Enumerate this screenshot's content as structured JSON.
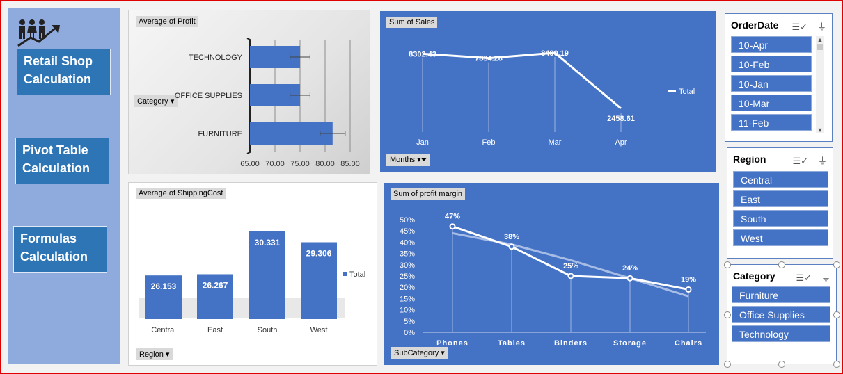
{
  "nav": {
    "retail": "Retail Shop Calculation",
    "pivot": "Pivot Table Calculation",
    "formulas": "Formulas Calculation"
  },
  "profit_chart": {
    "title": "Average of Profit",
    "filter_label": "Category",
    "chart_data": {
      "type": "bar",
      "categories": [
        "TECHNOLOGY",
        "OFFICE SUPPLIES",
        "FURNITURE"
      ],
      "values": [
        75.0,
        75.0,
        81.5
      ],
      "error": [
        2.0,
        2.0,
        2.5
      ],
      "xlim": [
        65,
        85
      ],
      "xticks": [
        "65.00",
        "70.00",
        "75.00",
        "80.00",
        "85.00"
      ]
    }
  },
  "sales_chart": {
    "title": "Sum of Sales",
    "filter_label": "Months",
    "legend": "Total",
    "chart_data": {
      "type": "line",
      "categories": [
        "Jan",
        "Feb",
        "Mar",
        "Apr"
      ],
      "values": [
        8302.43,
        7834.28,
        8400.19,
        2458.61
      ],
      "labels": [
        "8302.43",
        "7834.28",
        "8400.19",
        "2458.61"
      ],
      "series": [
        {
          "name": "Total",
          "values": [
            8302.43,
            7834.28,
            8400.19,
            2458.61
          ]
        }
      ]
    }
  },
  "shipping_chart": {
    "title": "Average of ShippingCost",
    "filter_label": "Region",
    "legend": "Total",
    "chart_data": {
      "type": "bar",
      "categories": [
        "Central",
        "East",
        "South",
        "West"
      ],
      "values": [
        26.153,
        26.267,
        30.331,
        29.306
      ],
      "labels": [
        "26.153",
        "26.267",
        "30.331",
        "29.306"
      ],
      "series": [
        {
          "name": "Total",
          "values": [
            26.153,
            26.267,
            30.331,
            29.306
          ]
        }
      ]
    }
  },
  "margin_chart": {
    "title": "Sum of profit margin",
    "filter_label": "SubCategory",
    "chart_data": {
      "type": "line",
      "categories": [
        "Phones",
        "Tables",
        "Binders",
        "Storage",
        "Chairs"
      ],
      "values": [
        47,
        38,
        25,
        24,
        19
      ],
      "labels": [
        "47%",
        "38%",
        "25%",
        "24%",
        "19%"
      ],
      "ylim": [
        0,
        50
      ],
      "yticks": [
        "50%",
        "45%",
        "40%",
        "35%",
        "30%",
        "25%",
        "20%",
        "15%",
        "10%",
        "5%",
        "0%"
      ],
      "trendline": [
        44,
        39,
        32,
        24,
        16
      ]
    }
  },
  "slicers": {
    "orderdate": {
      "title": "OrderDate",
      "items": [
        "10-Apr",
        "10-Feb",
        "10-Jan",
        "10-Mar",
        "11-Feb"
      ]
    },
    "region": {
      "title": "Region",
      "items": [
        "Central",
        "East",
        "South",
        "West"
      ]
    },
    "category": {
      "title": "Category",
      "items": [
        "Furniture",
        "Office Supplies",
        "Technology"
      ]
    }
  },
  "colors": {
    "accent": "#4472c4",
    "sidebar": "#8faadc",
    "nav_button": "#2e75b6",
    "bar": "#4472c4"
  }
}
